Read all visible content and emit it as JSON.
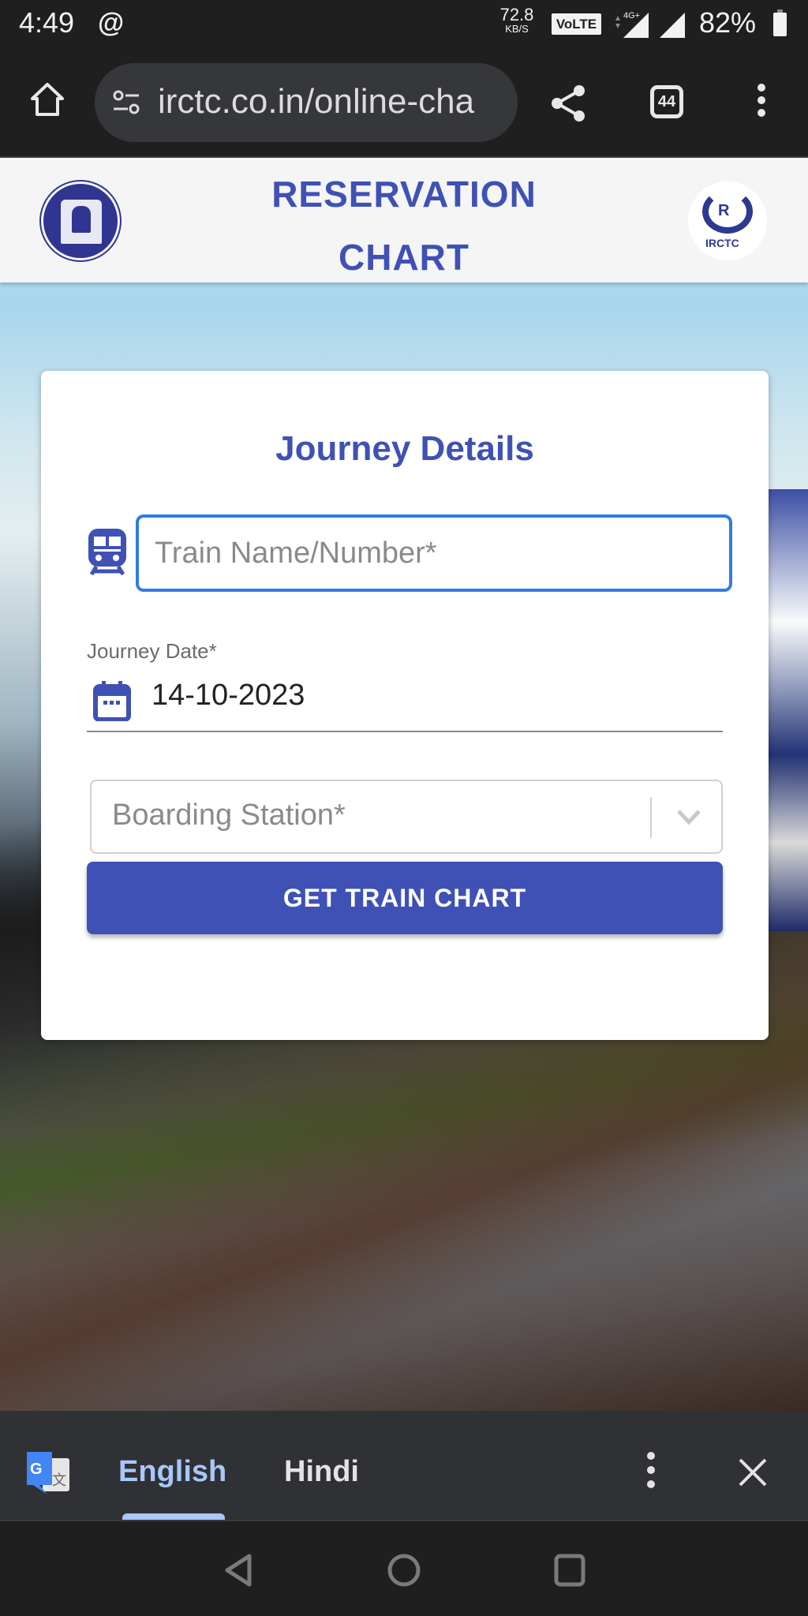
{
  "status_bar": {
    "time": "4:49",
    "app_icon": "threads-icon",
    "net_speed_value": "72.8",
    "net_speed_unit": "KB/S",
    "volte": "VoLTE",
    "network": "4G+",
    "battery": "82%"
  },
  "browser": {
    "url": "irctc.co.in/online-cha",
    "tab_count": "44",
    "icons": [
      "home-icon",
      "site-settings-icon",
      "share-icon",
      "tabs-icon",
      "more-menu-icon"
    ]
  },
  "header": {
    "title_line1": "RESERVATION",
    "title_line2": "CHART",
    "left_logo": "Indian Railways",
    "right_logo": "IRCTC",
    "right_logo_mark": "R"
  },
  "form": {
    "title": "Journey Details",
    "train_input": {
      "placeholder": "Train Name/Number*",
      "value": ""
    },
    "journey_date": {
      "label": "Journey Date*",
      "value": "14-10-2023"
    },
    "boarding_station": {
      "placeholder": "Boarding Station*",
      "value": ""
    },
    "submit_label": "GET TRAIN CHART"
  },
  "translate_bar": {
    "languages": [
      "English",
      "Hindi"
    ],
    "selected": "English"
  },
  "colors": {
    "primary": "#3f51b5",
    "focus_border": "#2f7de1",
    "translate_selected": "#a8c7fa"
  }
}
